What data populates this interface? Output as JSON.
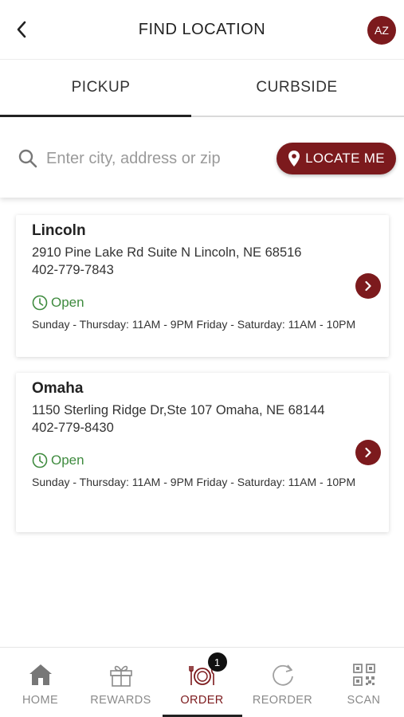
{
  "header": {
    "title": "FIND LOCATION",
    "avatar_initials": "AZ",
    "back_icon": "chevron-left-icon"
  },
  "tabs": [
    {
      "label": "PICKUP",
      "active": true
    },
    {
      "label": "CURBSIDE",
      "active": false
    }
  ],
  "search": {
    "placeholder": "Enter city, address or zip",
    "value": "",
    "locate_label": "LOCATE ME"
  },
  "locations": [
    {
      "name": "Lincoln",
      "address": "2910 Pine Lake Rd Suite N Lincoln, NE 68516",
      "phone": "402-779-7843",
      "status": "Open",
      "hours": "Sunday - Thursday: 11AM - 9PM Friday - Saturday: 11AM - 10PM"
    },
    {
      "name": "Omaha",
      "address": "1150 Sterling Ridge Dr,Ste 107 Omaha, NE 68144",
      "phone": "402-779-8430",
      "status": "Open",
      "hours": "Sunday - Thursday: 11AM - 9PM Friday - Saturday: 11AM - 10PM"
    }
  ],
  "bottom_nav": [
    {
      "label": "HOME",
      "icon": "home-icon",
      "active": false
    },
    {
      "label": "REWARDS",
      "icon": "gift-icon",
      "active": false
    },
    {
      "label": "ORDER",
      "icon": "plate-utensils-icon",
      "active": true,
      "badge": "1"
    },
    {
      "label": "REORDER",
      "icon": "refresh-icon",
      "active": false
    },
    {
      "label": "SCAN",
      "icon": "qr-code-icon",
      "active": false
    }
  ],
  "colors": {
    "brand": "#7c1a1d",
    "open_status": "#3f8b3f",
    "inactive_nav": "#8a8a8a"
  }
}
